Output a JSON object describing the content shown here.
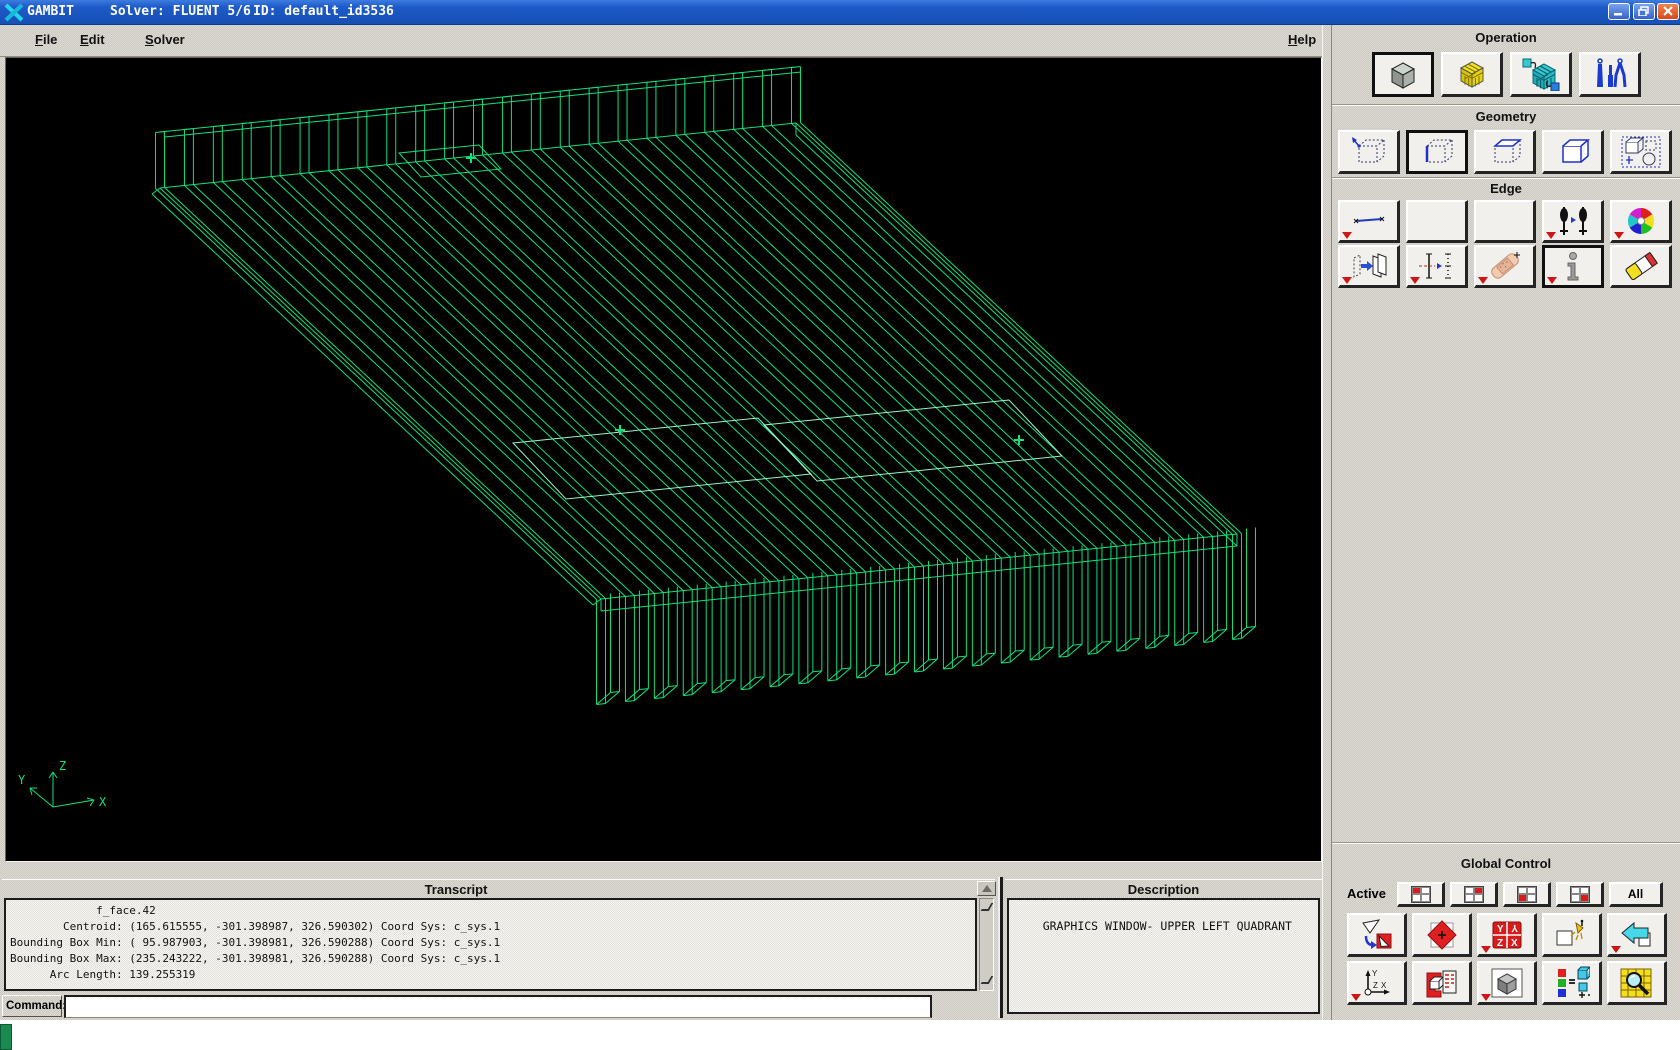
{
  "title_bar": {
    "app_name": "GAMBIT",
    "solver": "Solver: FLUENT 5/6",
    "session_id": "ID: default_id3536"
  },
  "menu_bar": {
    "items": [
      {
        "label": "File"
      },
      {
        "label": "Edit"
      },
      {
        "label": "Solver"
      }
    ],
    "help_label": "Help"
  },
  "toolbox": {
    "operation": {
      "title": "Operation"
    },
    "geometry": {
      "title": "Geometry"
    },
    "edge": {
      "title": "Edge"
    },
    "global_control": {
      "title": "Global Control",
      "active_label": "Active",
      "all_label": "All",
      "orient_letters": {
        "tl": "Y",
        "tr": "Y",
        "bl": "Z",
        "br": "X"
      }
    }
  },
  "transcript": {
    "title": "Transcript",
    "lines": [
      "             f_face.42",
      "        Centroid: (165.615555, -301.398987, 326.590302) Coord Sys: c_sys.1",
      "Bounding Box Min: ( 95.987903, -301.398981, 326.590288) Coord Sys: c_sys.1",
      "Bounding Box Max: (235.243222, -301.398981, 326.590288) Coord Sys: c_sys.1",
      "      Arc Length: 139.255319"
    ]
  },
  "description": {
    "title": "Description",
    "text": "GRAPHICS WINDOW- UPPER LEFT QUADRANT"
  },
  "command": {
    "label": "Command:",
    "value": ""
  },
  "viewport": {
    "background": "#000000",
    "wireframe_color": "#12e07a",
    "highlight_color": "#96f8c8",
    "axis_labels": {
      "x": "X",
      "y": "Y",
      "z": "Z"
    },
    "model": {
      "type": "finned-plate-wireframe",
      "fin_count": 23
    }
  },
  "colors": {
    "titlebar_blue": "#1c56c8",
    "panel_gray": "#d6d3cb",
    "selection_red": "#cf1616",
    "close_button": "#e0551f",
    "logo_cyan": "#22d8e8"
  }
}
